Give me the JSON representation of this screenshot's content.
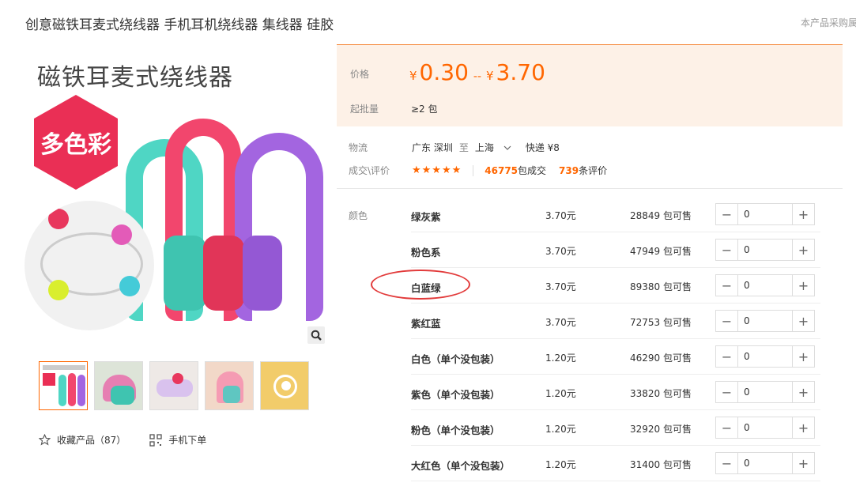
{
  "product": {
    "title": "创意磁铁耳麦式绕线器 手机耳机绕线器 集线器 硅胶",
    "procurement_link": "本产品采购属"
  },
  "gallery": {
    "image_heading": "磁铁耳麦式绕线器",
    "badge": "多色彩",
    "thumbnail_count": 5
  },
  "actions": {
    "favorite_label": "收藏产品（87）",
    "mobile_order_label": "手机下单"
  },
  "price": {
    "label": "价格",
    "currency": "¥",
    "min": "0.30",
    "max": "3.70",
    "separator": "--",
    "moq_label": "起批量",
    "moq_value": "≥2 包"
  },
  "logistics": {
    "label": "物流",
    "from": "广东 深圳",
    "to_word": "至",
    "to": "上海",
    "shipping": "快递 ¥8"
  },
  "rating": {
    "label": "成交\\评价",
    "stars": "★★★★★",
    "deals_count": "46775",
    "deals_suffix": "包成交",
    "reviews_count": "739",
    "reviews_suffix": "条评价"
  },
  "variants_label": "颜色",
  "variants": [
    {
      "name": "绿灰紫",
      "price": "3.70元",
      "stock": "28849 包可售",
      "qty": "0"
    },
    {
      "name": "粉色系",
      "price": "3.70元",
      "stock": "47949 包可售",
      "qty": "0"
    },
    {
      "name": "白蓝绿",
      "price": "3.70元",
      "stock": "89380 包可售",
      "qty": "0"
    },
    {
      "name": "紫红蓝",
      "price": "3.70元",
      "stock": "72753 包可售",
      "qty": "0"
    },
    {
      "name": "白色（单个没包装）",
      "price": "1.20元",
      "stock": "46290 包可售",
      "qty": "0"
    },
    {
      "name": "紫色（单个没包装）",
      "price": "1.20元",
      "stock": "33820 包可售",
      "qty": "0"
    },
    {
      "name": "粉色（单个没包装）",
      "price": "1.20元",
      "stock": "32920 包可售",
      "qty": "0"
    },
    {
      "name": "大红色（单个没包装）",
      "price": "1.20元",
      "stock": "31400 包可售",
      "qty": "0"
    }
  ],
  "stepper": {
    "minus": "−",
    "plus": "+"
  },
  "colors": {
    "accent": "#ff6600",
    "price_panel_bg": "#fdf1e7",
    "badge_red": "#ea2f55",
    "annotation_red": "#e23b3b"
  }
}
